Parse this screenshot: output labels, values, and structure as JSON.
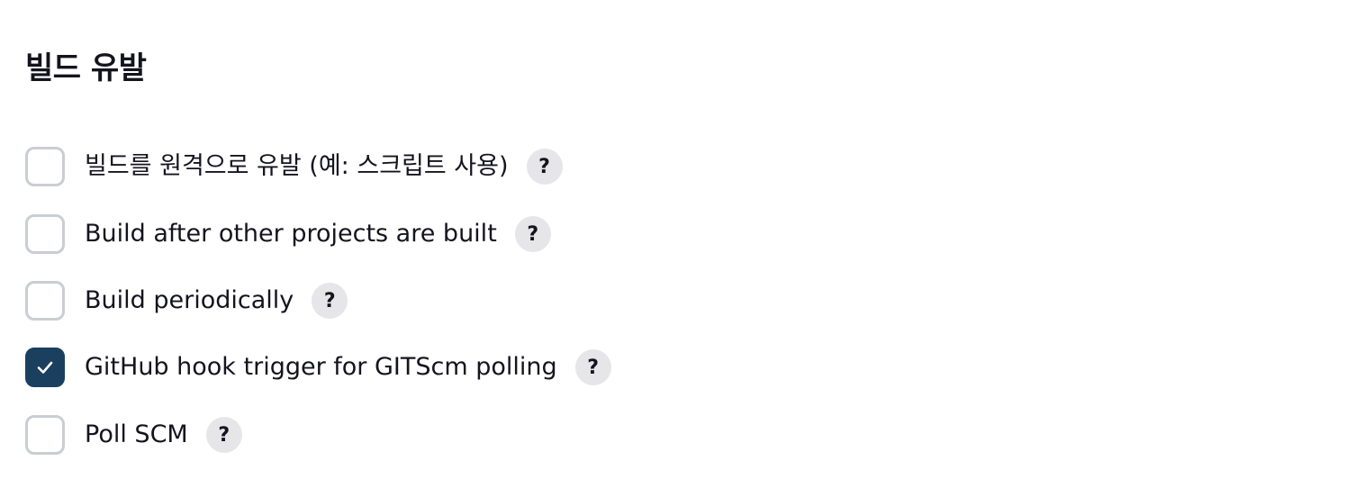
{
  "section": {
    "title": "빌드 유발"
  },
  "options": [
    {
      "label": "빌드를 원격으로 유발 (예: 스크립트 사용)",
      "checked": false,
      "help": "?"
    },
    {
      "label": "Build after other projects are built",
      "checked": false,
      "help": "?"
    },
    {
      "label": "Build periodically",
      "checked": false,
      "help": "?"
    },
    {
      "label": "GitHub hook trigger for GITScm polling",
      "checked": true,
      "help": "?"
    },
    {
      "label": "Poll SCM",
      "checked": false,
      "help": "?"
    }
  ],
  "icons": {
    "help": "question-mark-icon",
    "check": "checkmark-icon"
  },
  "colors": {
    "checkbox_checked_fill": "#1b3f5f",
    "checkbox_border": "#c9ced3",
    "help_badge_bg": "#e6e6e9",
    "text": "#14141f"
  }
}
